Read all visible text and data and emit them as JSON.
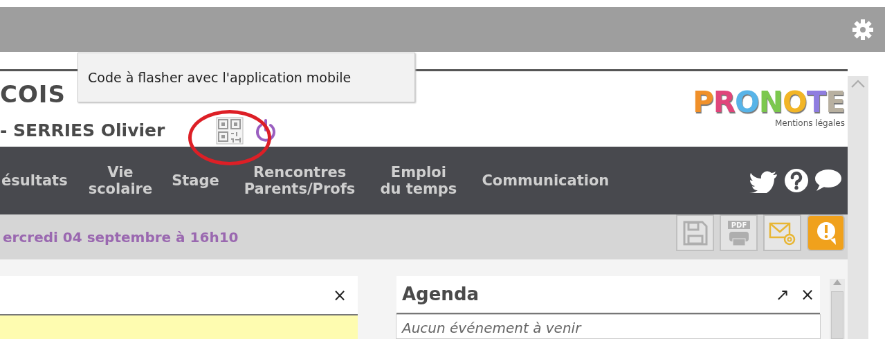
{
  "tooltip": {
    "text": "Code à flasher avec l'application mobile"
  },
  "header": {
    "school": "COIS",
    "user": "- SERRIES Olivier",
    "qr_annotated": true
  },
  "logo": {
    "letters": [
      {
        "char": "P",
        "color": "#f0902a"
      },
      {
        "char": "R",
        "color": "#e0457b"
      },
      {
        "char": "O",
        "color": "#58b4e8"
      },
      {
        "char": "N",
        "color": "#7cc84e"
      },
      {
        "char": "O",
        "color": "#f2b526"
      },
      {
        "char": "T",
        "color": "#8f7de0"
      },
      {
        "char": "E",
        "color": "#b8b0a0"
      }
    ],
    "link": "Mentions légales"
  },
  "nav": {
    "items": [
      "ésultats",
      "Vie\nscolaire",
      "Stage",
      "Rencontres\nParents/Profs",
      "Emploi\ndu temps",
      "Communication"
    ]
  },
  "date_line": "ercredi 04 septembre à 16h10",
  "toolbar": [
    {
      "kind": "save",
      "disabled": true
    },
    {
      "kind": "pdf",
      "label": "PDF",
      "disabled": true
    },
    {
      "kind": "mail",
      "disabled": false
    },
    {
      "kind": "alert",
      "disabled": false
    }
  ],
  "panels": [
    {
      "kind": "note",
      "close": "×"
    },
    {
      "kind": "agenda",
      "title": "Agenda",
      "expand": "↗",
      "close": "×",
      "empty_text": "Aucun événement à venir"
    }
  ]
}
